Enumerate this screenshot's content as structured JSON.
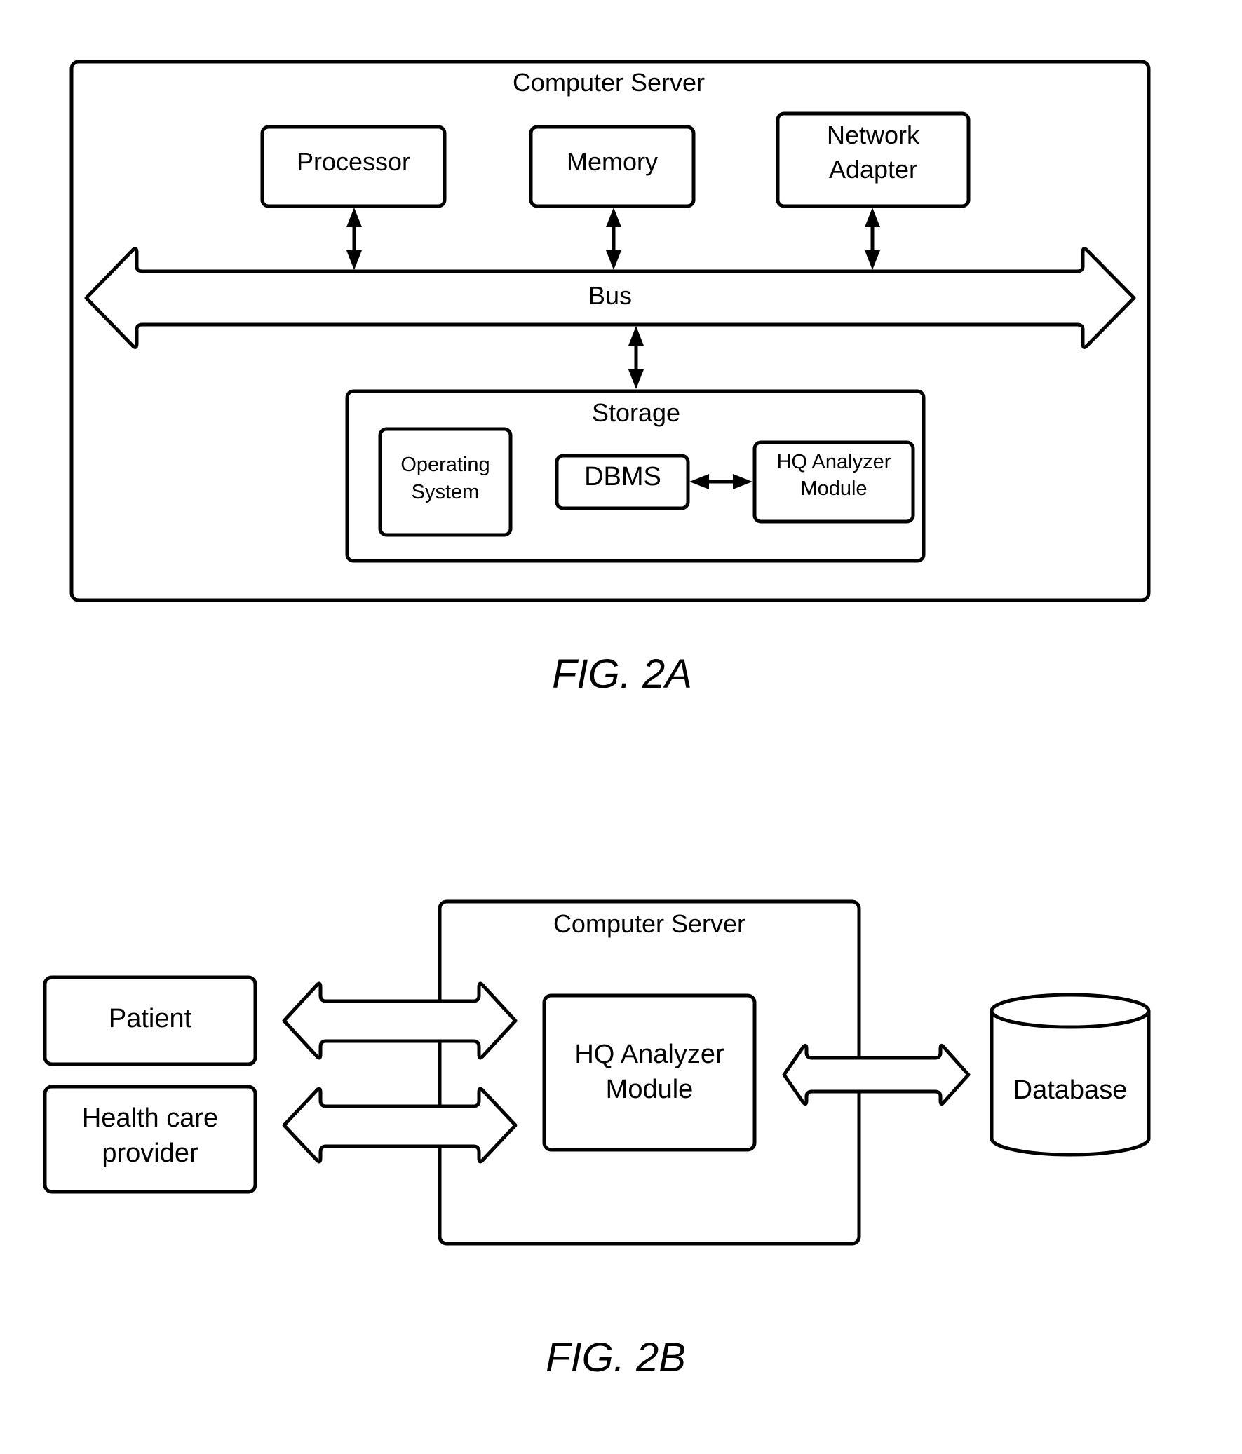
{
  "figure_2a": {
    "caption": "FIG. 2A",
    "container_label": "Computer Server",
    "components": {
      "processor": "Processor",
      "memory": "Memory",
      "network_adapter": [
        "Network",
        "Adapter"
      ]
    },
    "bus_label": "Bus",
    "storage": {
      "label": "Storage",
      "operating_system": [
        "Operating",
        "System"
      ],
      "dbms": "DBMS",
      "hq_analyzer_module": [
        "HQ Analyzer",
        "Module"
      ]
    },
    "connections": [
      {
        "from": "Processor",
        "to": "Bus",
        "type": "bidirectional"
      },
      {
        "from": "Memory",
        "to": "Bus",
        "type": "bidirectional"
      },
      {
        "from": "Network Adapter",
        "to": "Bus",
        "type": "bidirectional"
      },
      {
        "from": "Bus",
        "to": "Storage",
        "type": "bidirectional"
      },
      {
        "from": "DBMS",
        "to": "HQ Analyzer Module",
        "type": "bidirectional"
      }
    ]
  },
  "figure_2b": {
    "caption": "FIG. 2B",
    "patient": "Patient",
    "health_care_provider": [
      "Health care",
      "provider"
    ],
    "container_label": "Computer Server",
    "hq_analyzer_module": [
      "HQ Analyzer",
      "Module"
    ],
    "database": "Database",
    "connections": [
      {
        "from": "Patient",
        "to": "HQ Analyzer Module",
        "type": "bidirectional"
      },
      {
        "from": "Health care provider",
        "to": "HQ Analyzer Module",
        "type": "bidirectional"
      },
      {
        "from": "HQ Analyzer Module",
        "to": "Database",
        "type": "bidirectional"
      }
    ]
  }
}
